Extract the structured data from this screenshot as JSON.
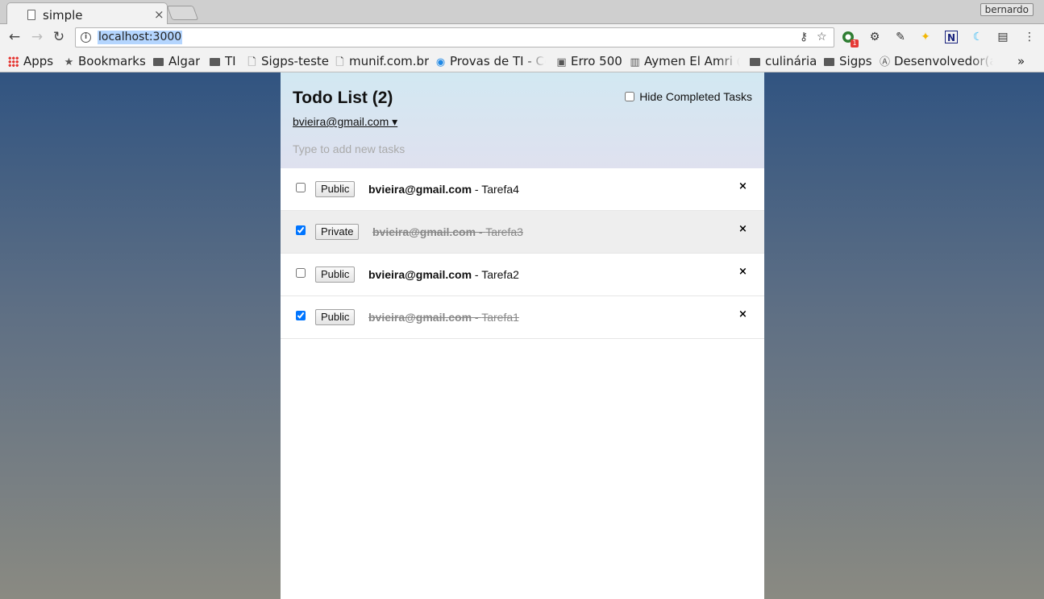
{
  "browser": {
    "tab_title": "simple",
    "tab_close": "×",
    "profile_name": "bernardo",
    "url": "localhost:3000",
    "bookmarks": [
      {
        "label": "Apps",
        "icon": "apps-grid-icon"
      },
      {
        "label": "Bookmarks",
        "icon": "star-icon"
      },
      {
        "label": "Algar",
        "icon": "folder-icon"
      },
      {
        "label": "TI",
        "icon": "folder-icon"
      },
      {
        "label": "Sigps-teste",
        "icon": "page-icon"
      },
      {
        "label": "munif.com.br",
        "icon": "page-icon"
      },
      {
        "label": "Provas de TI - Cor",
        "icon": "q-logo-icon"
      },
      {
        "label": "Erro 500",
        "icon": "image-icon"
      },
      {
        "label": "Aymen El Amri @",
        "icon": "book-icon"
      },
      {
        "label": "culinária",
        "icon": "folder-icon"
      },
      {
        "label": "Sigps",
        "icon": "folder-icon"
      },
      {
        "label": "Desenvolvedor(a",
        "icon": "a-circle-icon"
      }
    ],
    "bookmarks_overflow": "»",
    "extension_badge": "1"
  },
  "app": {
    "title": "Todo List (2)",
    "hide_completed_label": "Hide Completed Tasks",
    "hide_completed_checked": false,
    "user_menu": "bvieira@gmail.com ▾",
    "new_task_placeholder": "Type to add new tasks",
    "tasks": [
      {
        "checked": false,
        "privacy": "Public",
        "owner": "bvieira@gmail.com",
        "separator": " - ",
        "text": "Tarefa4",
        "delete": "×"
      },
      {
        "checked": true,
        "privacy": "Private",
        "owner": "bvieira@gmail.com",
        "separator": " - ",
        "text": "Tarefa3",
        "delete": "×"
      },
      {
        "checked": false,
        "privacy": "Public",
        "owner": "bvieira@gmail.com",
        "separator": " - ",
        "text": "Tarefa2",
        "delete": "×"
      },
      {
        "checked": true,
        "privacy": "Public",
        "owner": "bvieira@gmail.com",
        "separator": " - ",
        "text": "Tarefa1",
        "delete": "×"
      }
    ]
  }
}
